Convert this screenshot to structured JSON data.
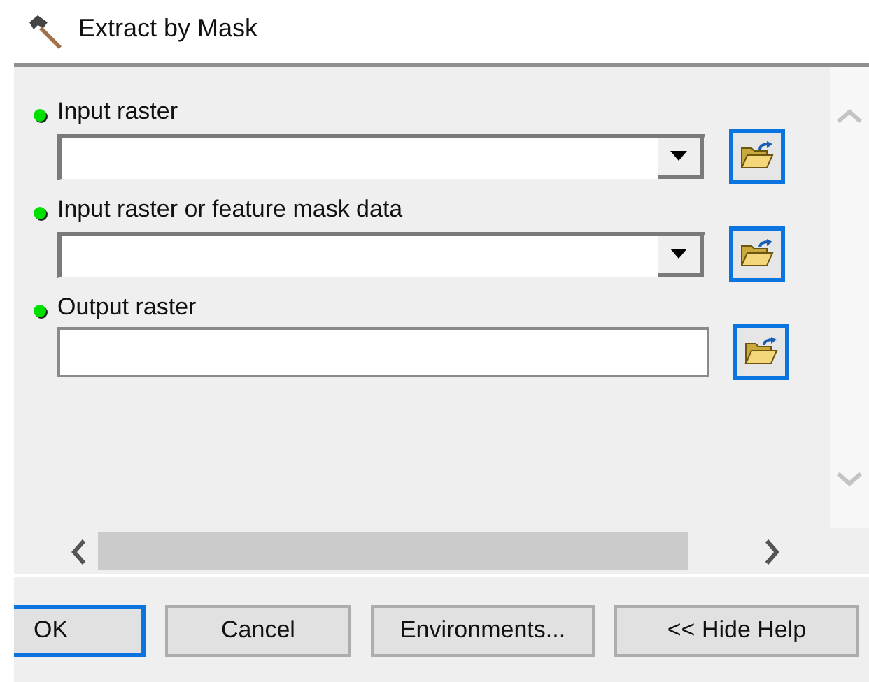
{
  "window": {
    "title": "Extract by Mask"
  },
  "parameters": [
    {
      "label": "Input raster",
      "kind": "combo",
      "required": true
    },
    {
      "label": "Input raster or feature mask data",
      "kind": "combo",
      "required": true
    },
    {
      "label": "Output raster",
      "kind": "text",
      "required": true
    }
  ],
  "buttons": [
    {
      "label": "OK",
      "focused": true
    },
    {
      "label": "Cancel",
      "focused": false
    },
    {
      "label": "Environments...",
      "focused": false
    },
    {
      "label": "<< Hide Help",
      "focused": false
    }
  ]
}
